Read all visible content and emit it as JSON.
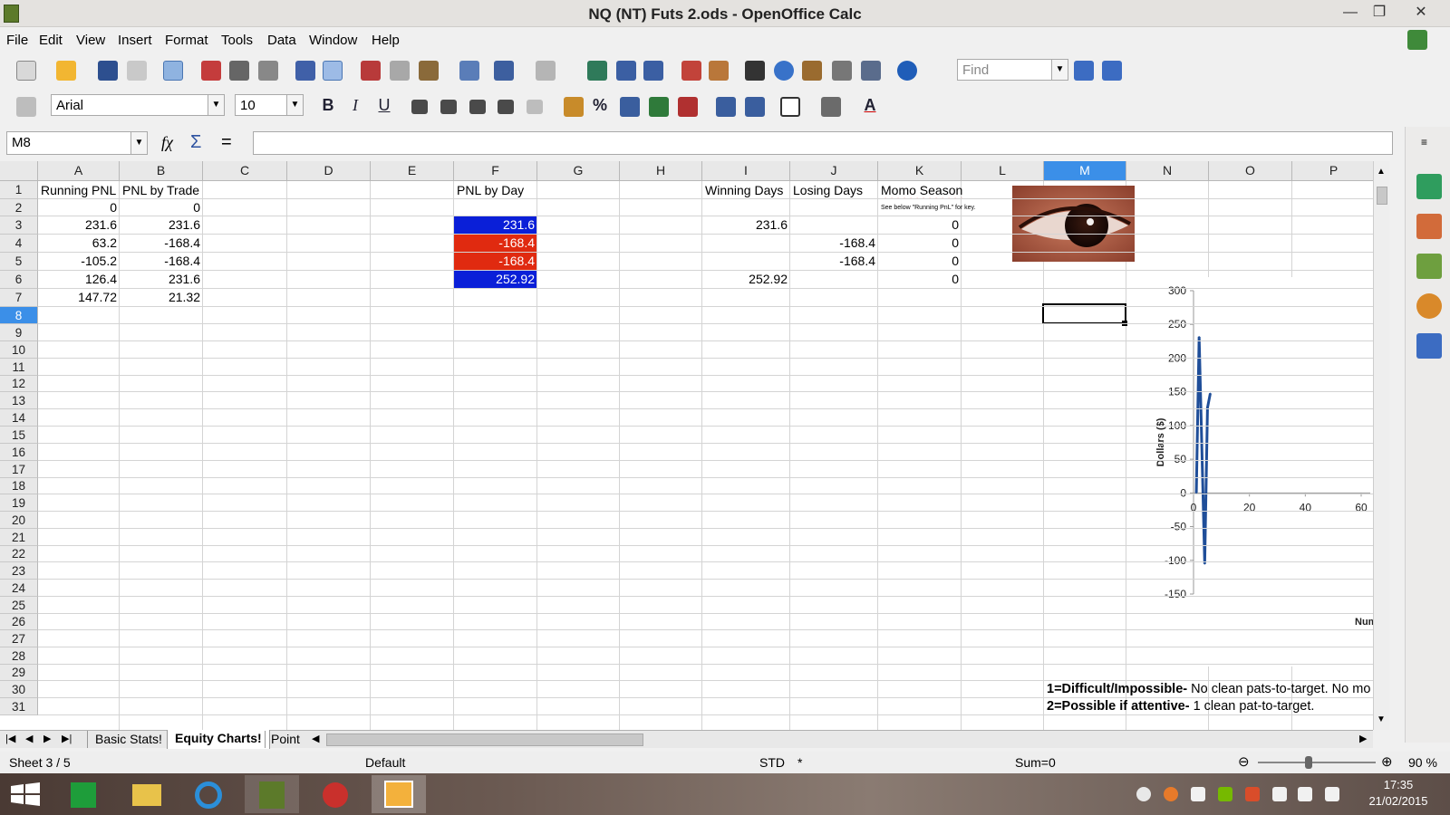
{
  "window": {
    "title": "NQ (NT) Futs 2.ods - OpenOffice Calc",
    "minimize": "—",
    "restore": "❐",
    "close": "✕"
  },
  "menu": [
    "File",
    "Edit",
    "View",
    "Insert",
    "Format",
    "Tools",
    "Data",
    "Window",
    "Help"
  ],
  "toolbar": {
    "find_placeholder": "Find"
  },
  "format_bar": {
    "font_name": "Arial",
    "font_size": "10",
    "bold": "B",
    "italic": "I",
    "underline": "U",
    "percent": "%",
    "font_color": "A"
  },
  "formula_bar": {
    "cell_ref": "M8",
    "function_wizard": "fχ",
    "sum": "Σ",
    "equals": "=",
    "formula": ""
  },
  "columns": [
    "A",
    "B",
    "C",
    "D",
    "E",
    "F",
    "G",
    "H",
    "I",
    "J",
    "K",
    "L",
    "M",
    "N",
    "O",
    "P"
  ],
  "selected_column": "M",
  "rows": [
    "1",
    "2",
    "3",
    "4",
    "5",
    "6",
    "7",
    "8",
    "9",
    "10",
    "11",
    "12",
    "13",
    "14",
    "15",
    "16",
    "17",
    "18",
    "19",
    "20",
    "21",
    "22",
    "23",
    "24",
    "25",
    "26",
    "27",
    "28",
    "29",
    "30",
    "31"
  ],
  "selected_row": "8",
  "headers": {
    "A1": "Running PNL",
    "B1": "PNL by Trade",
    "F1": "PNL by Day",
    "I1": "Winning Days",
    "J1": "Losing Days",
    "K1": "Momo Season",
    "K2": "See below \"Running PnL\" for key."
  },
  "col_A": [
    "0",
    "231.6",
    "63.2",
    "-105.2",
    "126.4",
    "147.72"
  ],
  "col_B": [
    "0",
    "231.6",
    "-168.4",
    "-168.4",
    "231.6",
    "21.32"
  ],
  "col_F": [
    "231.6",
    "-168.4",
    "-168.4",
    "252.92"
  ],
  "col_I": {
    "I3": "231.6",
    "I6": "252.92"
  },
  "col_J": {
    "J4": "-168.4",
    "J5": "-168.4"
  },
  "col_K": [
    "0",
    "0",
    "0",
    "0"
  ],
  "colors": {
    "positive_fill": "#0a1fd8",
    "negative_fill": "#e02a10",
    "selection": "#3b8fe8"
  },
  "notes": {
    "row30_bold": "1=Difficult/Impossible-",
    "row30_rest": " No clean pats-to-target. No mo",
    "row31_bold": "2=Possible if attentive-",
    "row31_rest": " 1 clean pat-to-target."
  },
  "chart_data": {
    "type": "line",
    "ylabel": "Dollars ($)",
    "xlabel": "Numb",
    "ylim": [
      -150,
      300
    ],
    "xlim": [
      0,
      60
    ],
    "yticks": [
      "300",
      "250",
      "200",
      "150",
      "100",
      "50",
      "0",
      "-50",
      "-100",
      "-150"
    ],
    "xticks": [
      "0",
      "20",
      "40",
      "60"
    ],
    "x": [
      1,
      2,
      3,
      4,
      5,
      6
    ],
    "values": [
      0,
      231.6,
      63.2,
      -105.2,
      126.4,
      147.72
    ],
    "line_color": "#1f4e99"
  },
  "sheet_tabs": [
    "Basic Stats!",
    "Equity Charts!",
    "Point"
  ],
  "active_tab": "Equity Charts!",
  "status": {
    "sheet": "Sheet 3 / 5",
    "style": "Default",
    "mode": "STD",
    "modified": "*",
    "sum": "Sum=0",
    "zoom": "90 %"
  },
  "taskbar": {
    "time": "17:35",
    "date": "21/02/2015"
  }
}
